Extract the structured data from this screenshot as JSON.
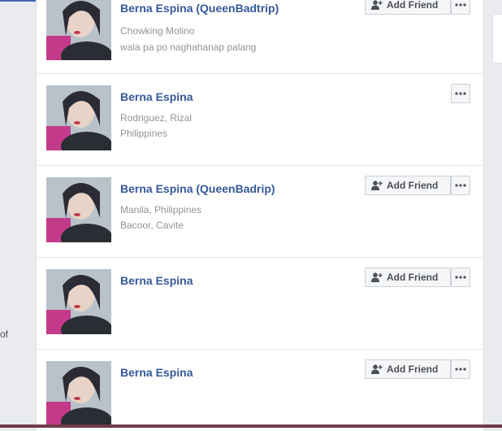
{
  "left_sidebar": {
    "cut_text": "of"
  },
  "results": [
    {
      "name": "Berna Espina (QueenBadtrip)",
      "details": [
        "Chowking Molino",
        "wala pa po naghahanap palang"
      ],
      "add_friend_label": "Add Friend",
      "has_add_friend": true
    },
    {
      "name": "Berna Espina",
      "details": [
        "Rodriguez, Rizal",
        "Philippines"
      ],
      "add_friend_label": "",
      "has_add_friend": false
    },
    {
      "name": "Berna Espina (QueenBadrip)",
      "details": [
        "Manila, Philippines",
        "Bacoor, Cavite"
      ],
      "add_friend_label": "Add Friend",
      "has_add_friend": true
    },
    {
      "name": "Berna Espina",
      "details": [],
      "add_friend_label": "Add Friend",
      "has_add_friend": true
    },
    {
      "name": "Berna Espina",
      "details": [],
      "add_friend_label": "Add Friend",
      "has_add_friend": true
    }
  ],
  "icons": {
    "add_friend": "person-plus-icon",
    "more": "ellipsis-icon"
  },
  "colors": {
    "name_link": "#365899",
    "secondary_text": "#90949c",
    "page_background": "#e9ebee"
  }
}
